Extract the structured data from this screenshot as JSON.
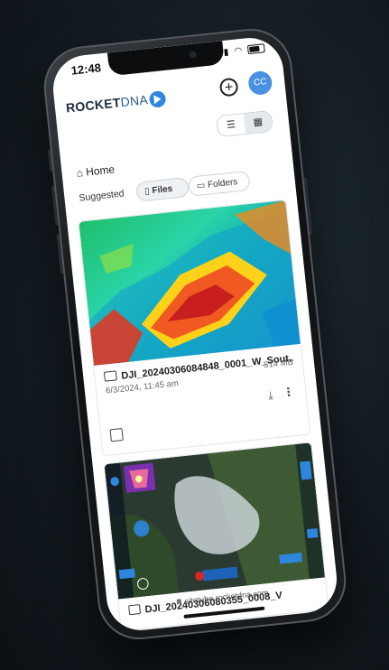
{
  "status_bar": {
    "time": "12:48",
    "signal_icon": "signal-icon",
    "wifi_icon": "wifi-icon",
    "battery_icon": "battery-icon"
  },
  "header": {
    "logo_bold": "ROCKET",
    "logo_light": "DNA",
    "add_icon": "plus-circle-icon",
    "avatar_initials": "CC"
  },
  "view_toggle": {
    "list_icon": "list-view-icon",
    "grid_icon": "grid-view-icon",
    "selected": "grid"
  },
  "breadcrumb": {
    "label": "Home",
    "icon": "home-icon"
  },
  "suggested": {
    "label": "Suggested",
    "tabs": [
      {
        "label": "Files",
        "selected": true
      },
      {
        "label": "Folders",
        "selected": false
      }
    ]
  },
  "files": [
    {
      "name": "DJI_20240306084848_0001_W_Sout...",
      "date": "6/3/2024, 11:45 am",
      "size": "514 MB",
      "icon": "image-stack-icon"
    },
    {
      "name": "DJI_20240306080355_0008_V",
      "icon": "image-icon"
    }
  ],
  "browser": {
    "url": "sitetube.rocketdna.com"
  },
  "colors": {
    "accent": "#2e86de",
    "avatar": "#4a90e2",
    "selected_chip": "#eef2f5"
  }
}
